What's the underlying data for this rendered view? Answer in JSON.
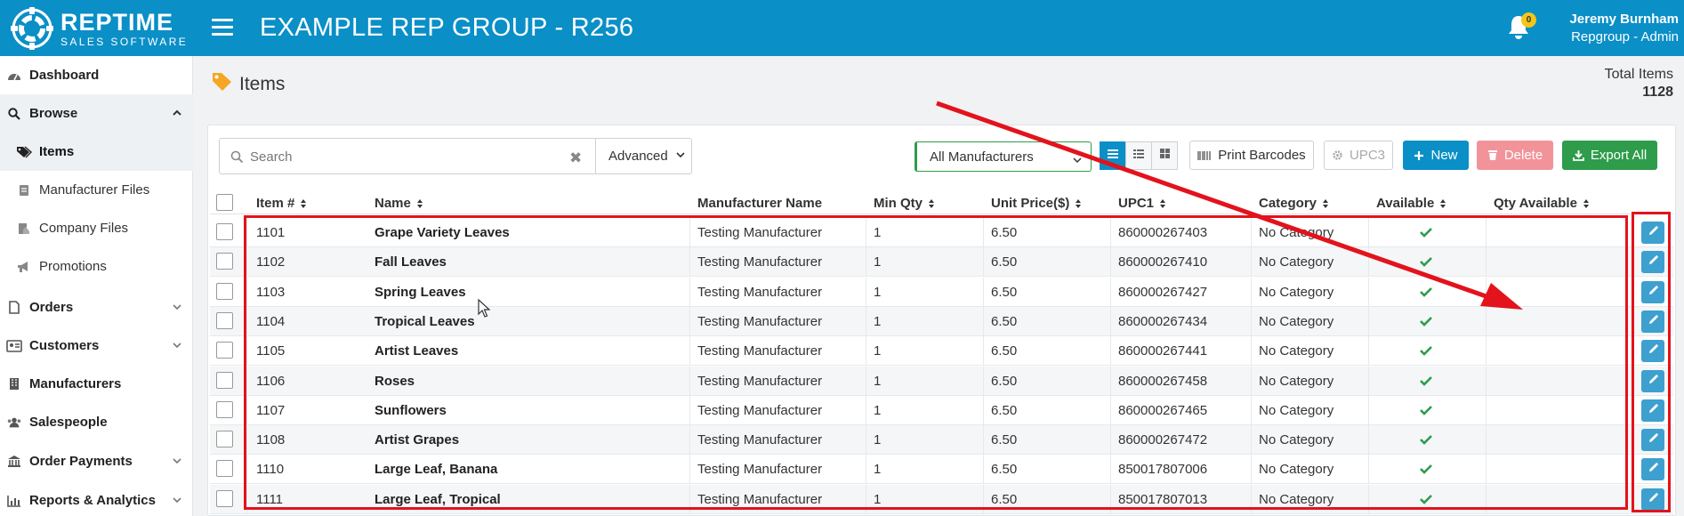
{
  "header": {
    "logo_main": "REPTIME",
    "logo_sub": "SALES SOFTWARE",
    "app_title": "EXAMPLE REP GROUP - R256",
    "notification_count": "0",
    "user_name": "Jeremy Burnham",
    "user_role": "Repgroup - Admin"
  },
  "sidebar": {
    "dashboard": "Dashboard",
    "browse": "Browse",
    "browse_items": [
      {
        "label": "Items",
        "icon": "tags-icon"
      },
      {
        "label": "Manufacturer Files",
        "icon": "file-icon"
      },
      {
        "label": "Company Files",
        "icon": "image-file-icon"
      },
      {
        "label": "Promotions",
        "icon": "bullhorn-icon"
      }
    ],
    "orders": "Orders",
    "customers": "Customers",
    "manufacturers": "Manufacturers",
    "salespeople": "Salespeople",
    "order_payments": "Order Payments",
    "reports": "Reports & Analytics"
  },
  "page": {
    "title": "Items",
    "total_label": "Total Items",
    "total_value": "1128"
  },
  "toolbar": {
    "search_placeholder": "Search",
    "advanced_label": "Advanced",
    "manufacturer_selected": "All Manufacturers",
    "print_barcodes": "Print Barcodes",
    "upc3": "UPC3",
    "new": "New",
    "delete": "Delete",
    "export_all": "Export All"
  },
  "table": {
    "columns": [
      "Item #",
      "Name",
      "Manufacturer Name",
      "Min Qty",
      "Unit Price($)",
      "UPC1",
      "Category",
      "Available",
      "Qty Available"
    ],
    "rows": [
      {
        "item": "1101",
        "name": "Grape Variety Leaves",
        "mfr": "Testing Manufacturer",
        "min": "1",
        "price": "6.50",
        "upc": "860000267403",
        "cat": "No Category",
        "qty": ""
      },
      {
        "item": "1102",
        "name": "Fall Leaves",
        "mfr": "Testing Manufacturer",
        "min": "1",
        "price": "6.50",
        "upc": "860000267410",
        "cat": "No Category",
        "qty": ""
      },
      {
        "item": "1103",
        "name": "Spring Leaves",
        "mfr": "Testing Manufacturer",
        "min": "1",
        "price": "6.50",
        "upc": "860000267427",
        "cat": "No Category",
        "qty": ""
      },
      {
        "item": "1104",
        "name": "Tropical Leaves",
        "mfr": "Testing Manufacturer",
        "min": "1",
        "price": "6.50",
        "upc": "860000267434",
        "cat": "No Category",
        "qty": ""
      },
      {
        "item": "1105",
        "name": "Artist Leaves",
        "mfr": "Testing Manufacturer",
        "min": "1",
        "price": "6.50",
        "upc": "860000267441",
        "cat": "No Category",
        "qty": ""
      },
      {
        "item": "1106",
        "name": "Roses",
        "mfr": "Testing Manufacturer",
        "min": "1",
        "price": "6.50",
        "upc": "860000267458",
        "cat": "No Category",
        "qty": ""
      },
      {
        "item": "1107",
        "name": "Sunflowers",
        "mfr": "Testing Manufacturer",
        "min": "1",
        "price": "6.50",
        "upc": "860000267465",
        "cat": "No Category",
        "qty": ""
      },
      {
        "item": "1108",
        "name": "Artist Grapes",
        "mfr": "Testing Manufacturer",
        "min": "1",
        "price": "6.50",
        "upc": "860000267472",
        "cat": "No Category",
        "qty": ""
      },
      {
        "item": "1110",
        "name": "Large Leaf, Banana",
        "mfr": "Testing Manufacturer",
        "min": "1",
        "price": "6.50",
        "upc": "850017807006",
        "cat": "No Category",
        "qty": ""
      },
      {
        "item": "1111",
        "name": "Large Leaf, Tropical",
        "mfr": "Testing Manufacturer",
        "min": "1",
        "price": "6.50",
        "upc": "850017807013",
        "cat": "No Category",
        "qty": ""
      }
    ]
  },
  "colors": {
    "brand": "#0a8fc7",
    "success": "#2e9c4a",
    "danger": "#f2939a",
    "annotation": "#e3121c"
  }
}
